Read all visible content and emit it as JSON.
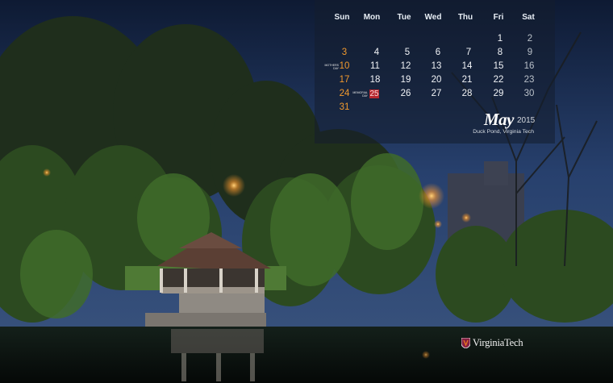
{
  "calendar": {
    "weekdays": [
      "Sun",
      "Mon",
      "Tue",
      "Wed",
      "Thu",
      "Fri",
      "Sat"
    ],
    "weeks": [
      [
        "",
        "",
        "",
        "",
        "",
        "1",
        "2"
      ],
      [
        "3",
        "4",
        "5",
        "6",
        "7",
        "8",
        "9"
      ],
      [
        "10",
        "11",
        "12",
        "13",
        "14",
        "15",
        "16"
      ],
      [
        "17",
        "18",
        "19",
        "20",
        "21",
        "22",
        "23"
      ],
      [
        "24",
        "25",
        "26",
        "27",
        "28",
        "29",
        "30"
      ],
      [
        "31",
        "",
        "",
        "",
        "",
        "",
        ""
      ]
    ],
    "month": "May",
    "year": "2015",
    "holidays": {
      "mothers_day": "MOTHERS DAY",
      "memorial_day": "MEMORIAL DAY"
    },
    "highlighted_day": "25"
  },
  "caption": "Duck Pond, Virginia Tech",
  "brand": {
    "name": "VirginiaTech"
  },
  "colors": {
    "sunday": "#f29a2e",
    "saturday": "#b9c0c8",
    "highlight": "#b5282f",
    "brand_maroon": "#861f41"
  },
  "icons": [
    "virginia-tech-shield-icon"
  ]
}
